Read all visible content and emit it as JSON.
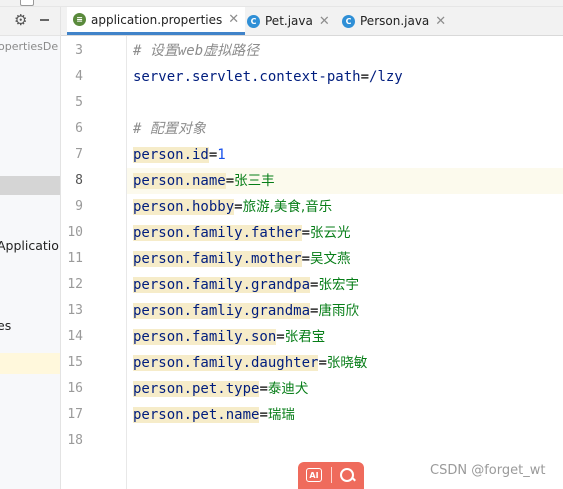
{
  "left_panel": {
    "rows": [
      {
        "text": "opertiesDe",
        "small": true
      },
      {
        "text": "Application",
        "small": false
      },
      {
        "text": "es",
        "small": false
      }
    ]
  },
  "tabs": [
    {
      "label": "application.properties",
      "icon": "properties-file-icon",
      "active": true
    },
    {
      "label": "Pet.java",
      "icon": "java-class-icon",
      "badge": "C",
      "active": false
    },
    {
      "label": "Person.java",
      "icon": "java-class-icon",
      "badge": "C",
      "active": false
    }
  ],
  "editor": {
    "current_line": 8,
    "lines": [
      {
        "num": "3",
        "kind": "comment",
        "text": "# 设置web虚拟路径"
      },
      {
        "num": "4",
        "kind": "plainkey",
        "key": "server.servlet.context-path",
        "eq": "=",
        "value": "/lzy"
      },
      {
        "num": "5",
        "kind": "blank"
      },
      {
        "num": "6",
        "kind": "comment",
        "text": "# 配置对象"
      },
      {
        "num": "7",
        "kind": "kv",
        "key": "person.id",
        "eq": "=",
        "value": "1",
        "numeric": true
      },
      {
        "num": "8",
        "kind": "kv",
        "key": "person.name",
        "eq": "=",
        "value": "张三丰"
      },
      {
        "num": "9",
        "kind": "kv",
        "key": "person.hobby",
        "eq": "=",
        "value": "旅游,美食,音乐"
      },
      {
        "num": "10",
        "kind": "kv",
        "key": "person.family.father",
        "eq": "=",
        "value": "张云光"
      },
      {
        "num": "11",
        "kind": "kv",
        "key": "person.family.mother",
        "eq": "=",
        "value": "吴文燕"
      },
      {
        "num": "12",
        "kind": "kv",
        "key": "person.family.grandpa",
        "eq": "=",
        "value": "张宏宇"
      },
      {
        "num": "13",
        "kind": "kv",
        "key": "person.famliy.grandma",
        "eq": "=",
        "value": "唐雨欣"
      },
      {
        "num": "14",
        "kind": "kv",
        "key": "person.family.son",
        "eq": "=",
        "value": "张君宝"
      },
      {
        "num": "15",
        "kind": "kv",
        "key": "person.family.daughter",
        "eq": "=",
        "value": "张晓敏"
      },
      {
        "num": "16",
        "kind": "kv",
        "key": "person.pet.type",
        "eq": "=",
        "value": "泰迪犬"
      },
      {
        "num": "17",
        "kind": "kv",
        "key": "person.pet.name",
        "eq": "=",
        "value": "瑞瑞"
      },
      {
        "num": "18",
        "kind": "blank"
      }
    ]
  },
  "ai_toolbar": {
    "ai_label": "AI"
  },
  "watermark": "CSDN @forget_wt",
  "colors": {
    "tab_underline": "#4083c9",
    "key_bg": "#f6ecc9",
    "current_line_bg": "#fcfaed",
    "value": "#067d17",
    "number": "#1750eb",
    "key_text": "#001d7e",
    "ai_bar": "#ef6b5c"
  }
}
